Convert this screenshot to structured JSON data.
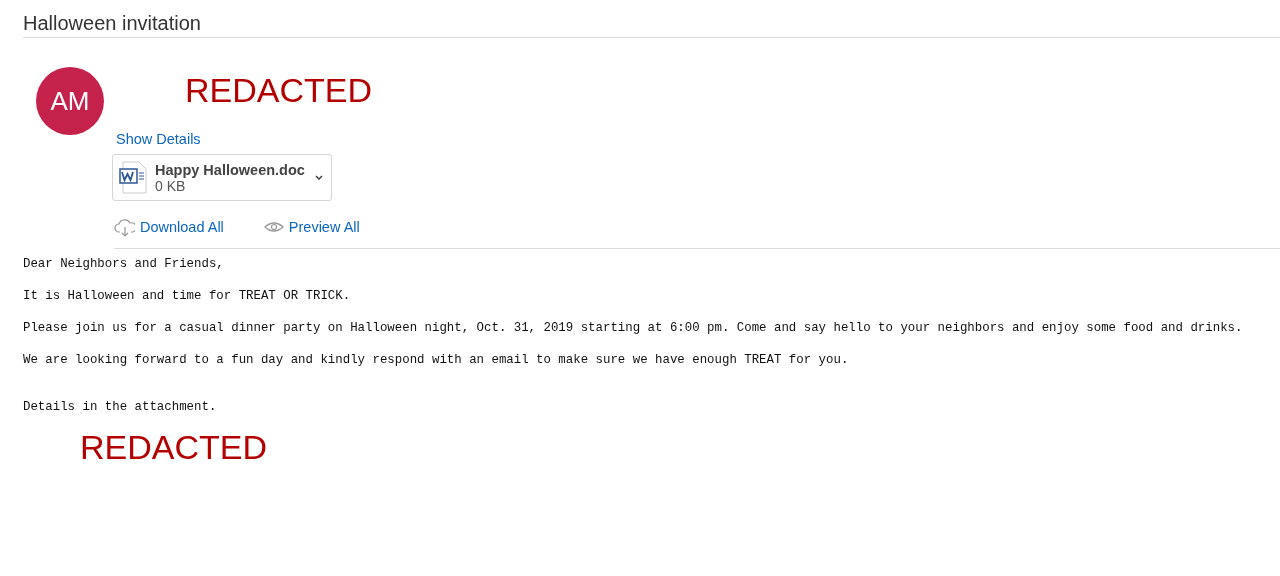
{
  "message": {
    "subject": "Halloween invitation",
    "sender": {
      "initials": "AM",
      "redacted_label": "REDACTED"
    },
    "show_details": "Show Details",
    "attachments": [
      {
        "name": "Happy Halloween.doc",
        "size": "0 KB"
      }
    ],
    "actions": [
      {
        "kind": "download",
        "label": "Download All"
      },
      {
        "kind": "preview",
        "label": "Preview All"
      }
    ],
    "body_sections": [
      {
        "paragraphs": [
          "Dear Neighbors and Friends,",
          "It is Halloween and time for TREAT OR TRICK.",
          "Please join us for a casual dinner party on Halloween night, Oct. 31, 2019 starting at 6:00 pm. Come and say hello to your neighbors and enjoy some food and drinks.",
          "We are looking forward to a fun day and kindly respond with an email to make sure we have enough TREAT for you."
        ]
      },
      {
        "paragraphs": [
          "Details in the attachment."
        ]
      }
    ],
    "signature_redacted": "REDACTED"
  }
}
